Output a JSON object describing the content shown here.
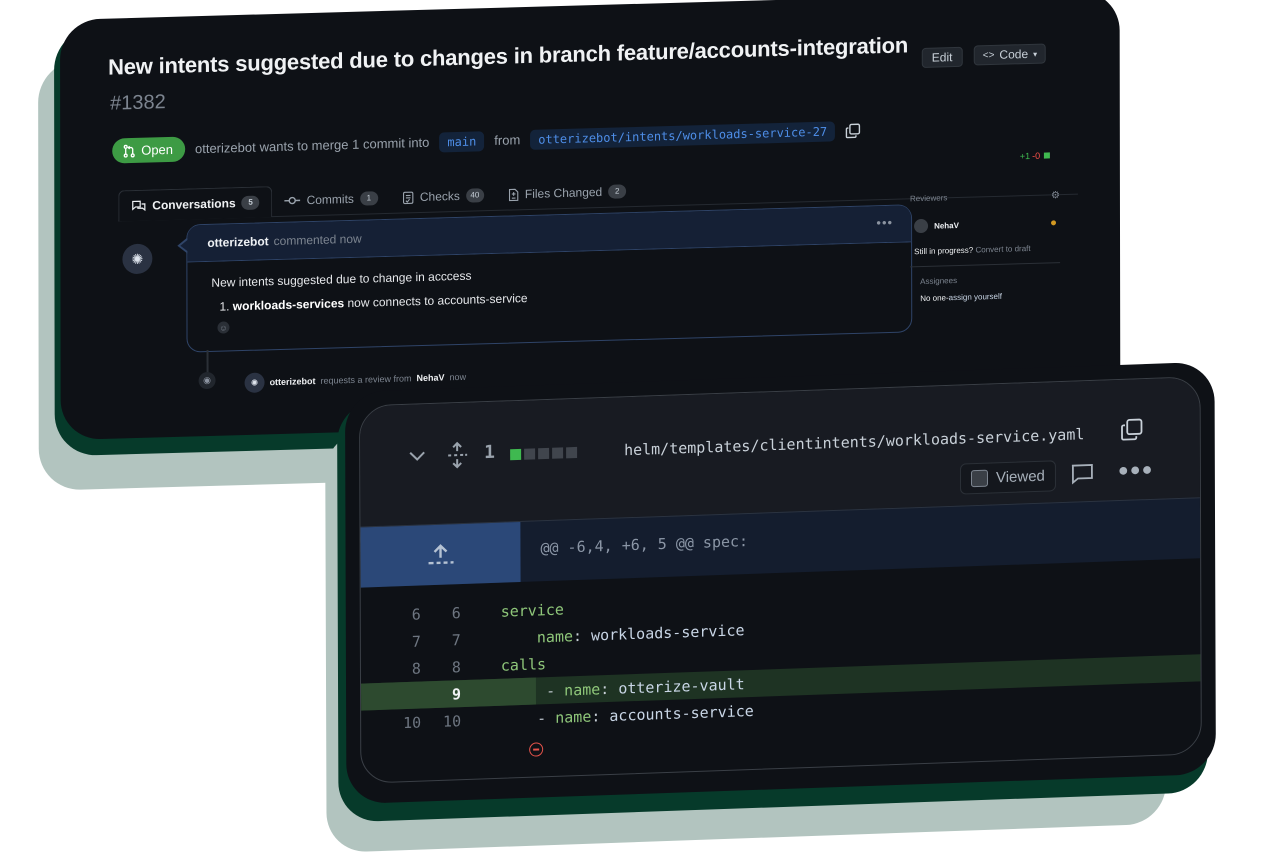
{
  "pr": {
    "title": "New intents suggested due to changes in branch feature/accounts-integration",
    "number": "#1382",
    "edit_label": "Edit",
    "code_label": "Code",
    "status": "Open",
    "author": "otterizebot",
    "merge_text": "wants to merge 1 commit into",
    "base_branch": "main",
    "from_label": "from",
    "head_branch": "otterizebot/intents/workloads-service-27",
    "diffstat_add": "+1",
    "diffstat_del": "-0",
    "colors": {
      "open": "#3d9b44",
      "add": "#3fb950",
      "del": "#f85149",
      "accent": "#4e8ee8"
    }
  },
  "tabs": [
    {
      "label": "Conversations",
      "count": "5",
      "icon": "conversation-icon",
      "active": true
    },
    {
      "label": "Commits",
      "count": "1",
      "icon": "commit-icon"
    },
    {
      "label": "Checks",
      "count": "40",
      "icon": "checklist-icon"
    },
    {
      "label": "Files Changed",
      "count": "2",
      "icon": "file-diff-icon"
    }
  ],
  "comment": {
    "author": "otterizebot",
    "meta": "commented now",
    "heading": "New intents suggested due to change in acccess",
    "item_number": "1.",
    "item_bold": "workloads-services",
    "item_text": "now connects to accounts-service"
  },
  "event": {
    "actor": "otterizebot",
    "text": "requests a review from",
    "target": "NehaV",
    "time": "now"
  },
  "sidebar": {
    "reviewers_label": "Reviewers",
    "reviewer": "NehaV",
    "draft_q": "Still in progress?",
    "draft_link": "Convert to draft",
    "assignees_label": "Assignees",
    "assignees_none": "No one-",
    "assignees_link": "assign yourself"
  },
  "file": {
    "changes": "1",
    "path": "helm/templates/clientintents/workloads-service.yaml",
    "viewed_label": "Viewed",
    "hunk": "@@ -6,4, +6, 5 @@ spec:",
    "lines": [
      {
        "old": "6",
        "new": "6",
        "sign": "",
        "indent": "",
        "key": "service",
        "sep": "",
        "val": ""
      },
      {
        "old": "7",
        "new": "7",
        "sign": "",
        "indent": "    ",
        "key": "name",
        "sep": ": ",
        "val": "workloads-service"
      },
      {
        "old": "8",
        "new": "8",
        "sign": "",
        "indent": "",
        "key": "calls",
        "sep": "",
        "val": ""
      },
      {
        "old": "",
        "new": "9",
        "sign": "+",
        "indent": "  - ",
        "key": "name",
        "sep": ": ",
        "val": "otterize-vault",
        "added": true
      },
      {
        "old": "10",
        "new": "10",
        "sign": "",
        "indent": "    - ",
        "key": "name",
        "sep": ": ",
        "val": "accounts-service"
      }
    ]
  }
}
